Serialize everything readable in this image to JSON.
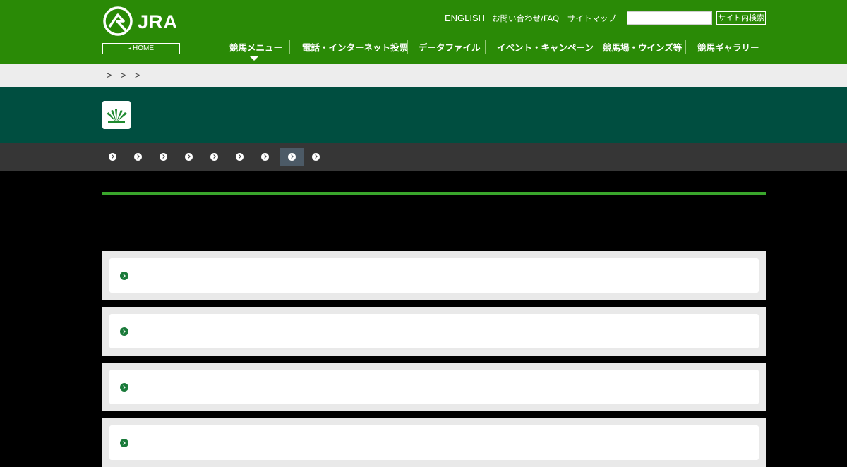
{
  "brand": {
    "logo_text": "JRA",
    "home_label": "HOME"
  },
  "utility_links": {
    "english": "ENGLISH",
    "faq": "お問い合わせ/FAQ",
    "sitemap": "サイトマップ"
  },
  "search": {
    "placeholder": "",
    "button_label": "サイト内検索"
  },
  "global_nav": [
    {
      "label": "競馬メニュー"
    },
    {
      "label": "電話・インターネット投票"
    },
    {
      "label": "データファイル"
    },
    {
      "label": "イベント・キャンペーン"
    },
    {
      "label": "競馬場・ウインズ等"
    },
    {
      "label": "競馬ギャラリー"
    }
  ],
  "breadcrumb": {
    "separators": [
      ">",
      ">",
      ">"
    ]
  },
  "sub_nav": {
    "item_count": 9,
    "active_index": 7
  },
  "cards": {
    "count": 4
  },
  "colors": {
    "header_green": "#2a8a06",
    "band_green": "#004e40",
    "accent_green": "#3aa62c",
    "subnav_gray": "#363636"
  },
  "icons": {
    "logo": "jra-logo-icon",
    "category": "turf-grass-icon",
    "arrow": "arrow-circle-icon"
  }
}
